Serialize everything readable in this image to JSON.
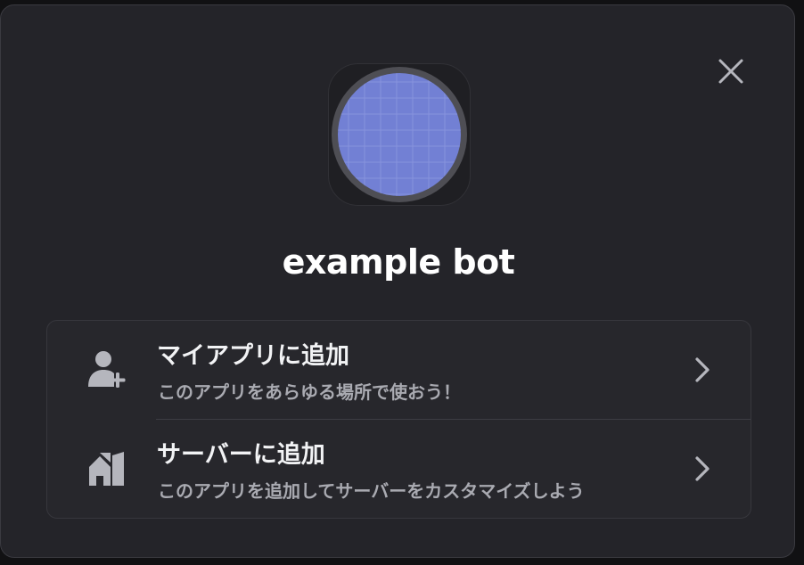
{
  "app": {
    "name": "example bot",
    "avatar_color": "#7280d4"
  },
  "modal": {
    "close_icon": "close-icon",
    "options": [
      {
        "id": "add-to-my-apps",
        "title": "マイアプリに追加",
        "subtitle": "このアプリをあらゆる場所で使おう！",
        "icon": "user-add-icon"
      },
      {
        "id": "add-to-server",
        "title": "サーバーに追加",
        "subtitle": "このアプリを追加してサーバーをカスタマイズしよう",
        "icon": "server-add-icon"
      }
    ]
  },
  "colors": {
    "modal_bg": "#242429",
    "card_bg": "#27272c",
    "text_primary": "#f2f3f5",
    "text_secondary": "#a9aab1",
    "icon": "#b5b6bd"
  }
}
